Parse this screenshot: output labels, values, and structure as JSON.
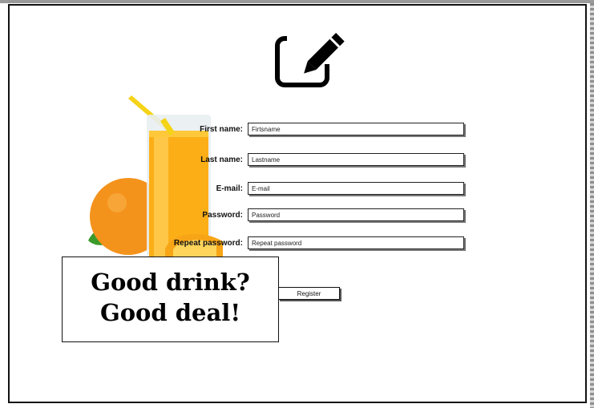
{
  "header": {
    "icon": "edit-icon"
  },
  "image": {
    "icon": "orange-juice-image"
  },
  "form": {
    "fields": [
      {
        "label": "First name:",
        "placeholder": "Firtsname"
      },
      {
        "label": "Last name:",
        "placeholder": "Lastname"
      },
      {
        "label": "E-mail:",
        "placeholder": "E-mail"
      },
      {
        "label": "Password:",
        "placeholder": "Password"
      },
      {
        "label": "Repeat password:",
        "placeholder": "Repeat password"
      }
    ],
    "register_label": "Register"
  },
  "promo": {
    "line1": "Good drink?",
    "line2": "Good deal!"
  }
}
